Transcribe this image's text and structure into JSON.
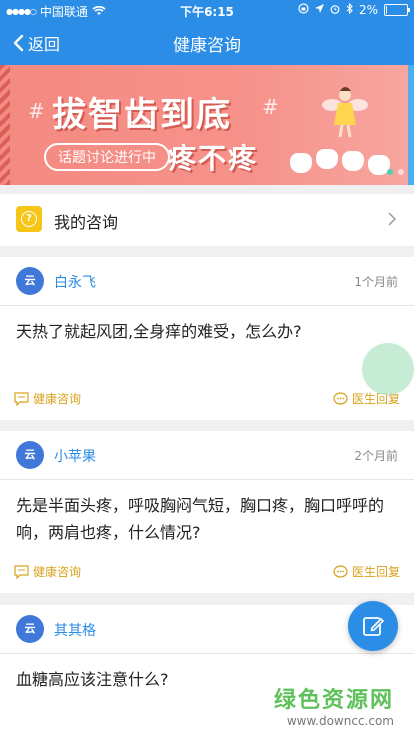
{
  "status_bar": {
    "carrier": "中国联通",
    "time": "下午6:15",
    "battery": "2%",
    "battery_level": 0.02
  },
  "nav": {
    "back_label": "返回",
    "title": "健康咨询"
  },
  "banner": {
    "title": "拔智齿到底",
    "tag": "话题讨论进行中",
    "subtitle": "疼不疼"
  },
  "my_consult": {
    "label": "我的咨询"
  },
  "posts": [
    {
      "user": "白永飞",
      "time": "1个月前",
      "question": "天热了就起风团,全身痒的难受，怎么办?",
      "category": "健康咨询",
      "reply": "医生回复"
    },
    {
      "user": "小苹果",
      "time": "2个月前",
      "question": "先是半面头疼，呼吸胸闷气短，胸口疼，胸口呼呼的响，两肩也疼，什么情况?",
      "category": "健康咨询",
      "reply": "医生回复"
    },
    {
      "user": "其其格",
      "time": "",
      "question": "血糖高应该注意什么?",
      "category": "",
      "reply": ""
    }
  ],
  "watermark": {
    "title": "绿色资源网",
    "url": "www.downcc.com"
  },
  "colors": {
    "primary": "#2b8de6",
    "accent_yellow": "#f5c518",
    "tag_color": "#d9a21b"
  }
}
